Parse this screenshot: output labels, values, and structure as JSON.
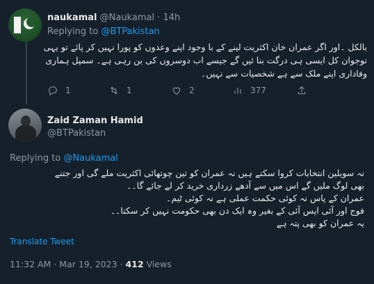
{
  "reply": {
    "name": "naukamal",
    "handle": "@Naukamal",
    "separator": "·",
    "time": "14h",
    "replying_prefix": "Replying to",
    "replying_to": "@BTPakistan",
    "lines": [
      "بالکل ۔اور اگر عمران خان اکثریت لینے کے با وجود اپنے وعدوں کو پورا نہیں کر پائے تو یہی",
      "نوجوان کل ایسی ہی درگت بنا ئیں گے جیسے اب دوسروں کی بن رہی ہے۔ سمپل ہماری",
      "وفاداری اپنے ملک سے ہے شخصیات سے نہیں۔"
    ],
    "actions": {
      "replies": "1",
      "retweets": "1",
      "likes": "2",
      "views": "377"
    }
  },
  "tweet": {
    "name": "Zaid Zaman Hamid",
    "handle": "@BTPakistan",
    "replying_prefix": "Replying to",
    "replying_to": "@Naukamal",
    "lines": [
      "نہ سویلین انتخابات کروا سکتے ہیں نہ عمران کو تین چوتھائی اکثریت ملے گی اور جتنے",
      "بھی لوگ ملیں گے اس میں سے آدھے زرداری خرید کر لے جائے گا۔۔",
      "عمران کے پاس نہ کوئی حکمت عملی ہے نہ کوئی ٹیم۔",
      "فوج اور آئی ایس آئی کے بغیر وہ ایک دن بھی حکومت نہیں کر سکتا۔۔",
      "یہ عمران کو بھی پتہ ہے"
    ],
    "translate_label": "Translate Tweet",
    "time": "11:32 AM",
    "separator": "·",
    "date": "Mar 19, 2023",
    "views_count": "412",
    "views_label": "Views"
  },
  "colors": {
    "background": "#15202b",
    "accent": "#1d9bf0",
    "text": "#e7e9ea",
    "muted": "#8b98a5"
  }
}
